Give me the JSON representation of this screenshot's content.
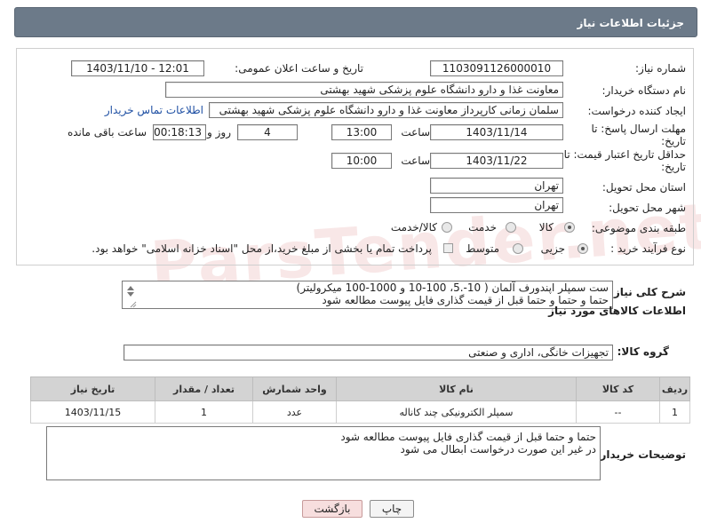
{
  "header": {
    "title": "جزئیات اطلاعات نیاز"
  },
  "form": {
    "need_number_label": "شماره نیاز:",
    "need_number": "1103091126000010",
    "announce_label": "تاریخ و ساعت اعلان عمومی:",
    "announce_value": "1403/11/10 - 12:01",
    "buyer_org_label": "نام دستگاه خریدار:",
    "buyer_org": "معاونت غذا و دارو دانشگاه علوم پزشکی شهید بهشتی",
    "creator_label": "ایجاد کننده درخواست:",
    "creator": "سلمان زمانی کارپرداز معاونت غذا و دارو دانشگاه علوم پزشکی شهید بهشتی",
    "contact_link": "اطلاعات تماس خریدار",
    "deadline_label_1": "مهلت ارسال پاسخ: تا",
    "deadline_label_2": "تاریخ:",
    "deadline_date": "1403/11/14",
    "time_label": "ساعت",
    "deadline_time": "13:00",
    "days_value": "4",
    "days_label": "روز و",
    "remaining_time": "00:18:13",
    "remaining_label": "ساعت باقی مانده",
    "validity_label_1": "حداقل تاریخ اعتبار قیمت: تا",
    "validity_label_2": "تاریخ:",
    "validity_date": "1403/11/22",
    "validity_time": "10:00",
    "province_label": "استان محل تحویل:",
    "province": "تهران",
    "city_label": "شهر محل تحویل:",
    "city": "تهران",
    "category_label": "طبقه بندی موضوعی:",
    "category_options": [
      "کالا",
      "خدمت",
      "کالا/خدمت"
    ],
    "category_selected": "کالا",
    "process_label": "نوع فرآیند خرید :",
    "process_options": [
      "جزیی",
      "متوسط"
    ],
    "process_selected": "جزیی",
    "payment_note": "پرداخت تمام یا بخشی از مبلغ خرید،از محل \"اسناد خزانه اسلامی\" خواهد بود."
  },
  "summary": {
    "label": "شرح کلی نیاز:",
    "lines": [
      "ست سمپلر اپندورف آلمان ( 10-.5، 100-10 و 1000-100 میکرولیتر)",
      "حتما و حتما و حتما قبل از قیمت گذاری فایل پیوست مطالعه شود"
    ]
  },
  "goods_section": {
    "title": "اطلاعات کالاهای مورد نیاز"
  },
  "goods_group": {
    "label": "گروه کالا:",
    "value": "تجهیزات خانگی، اداری و صنعتی"
  },
  "table": {
    "headers": [
      "ردیف",
      "کد کالا",
      "نام کالا",
      "واحد شمارش",
      "تعداد / مقدار",
      "تاریخ نیاز"
    ],
    "rows": [
      [
        "1",
        "--",
        "سمپلر الکترونیکی چند کاناله",
        "عدد",
        "1",
        "1403/11/15"
      ]
    ]
  },
  "buyer_notes": {
    "label": "توضیحات خریدار:",
    "lines": [
      "حتما و حتما قبل از قیمت گذاری فایل پیوست مطالعه شود",
      "در غیر این صورت درخواست ابطال می شود"
    ]
  },
  "buttons": {
    "print": "چاپ",
    "back": "بازگشت"
  },
  "watermark": "ParsTender.net",
  "colors": {
    "header_bg": "#6c7a89",
    "table_header_bg": "#d3d3d3",
    "back_button_bg": "#f7dede",
    "link": "#1e4fa3"
  }
}
